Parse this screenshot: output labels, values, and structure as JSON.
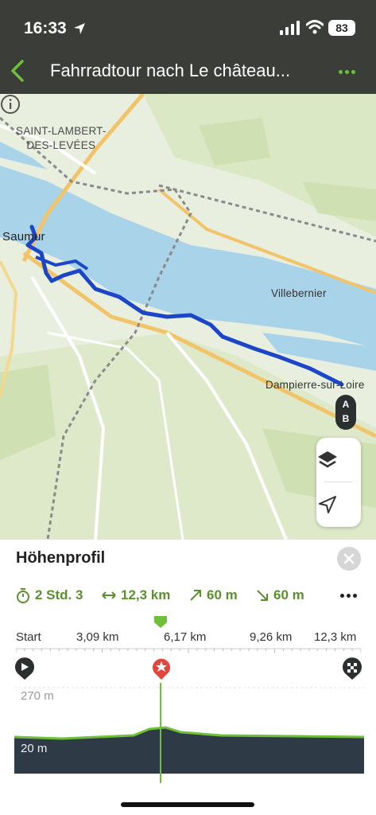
{
  "status_bar": {
    "time": "16:33",
    "battery": "83"
  },
  "header": {
    "title": "Fahrradtour nach Le château..."
  },
  "map": {
    "labels": {
      "town_line1": "SAINT-LAMBERT-",
      "town_line2": "DES-LEVÉES",
      "saumur": "Saumur",
      "villebernier": "Villebernier",
      "dampierre": "Dampierre-sur-Loire"
    },
    "marker": {
      "a": "A",
      "b": "B"
    },
    "route_color": "#1c46c8",
    "water_color": "#a9d3e8"
  },
  "elevation": {
    "title": "Höhenprofil",
    "stats": {
      "duration": "2 Std. 3",
      "distance": "12,3 km",
      "ascent": "60 m",
      "descent": "60 m"
    },
    "axis": [
      "Start",
      "3,09 km",
      "6,17 km",
      "9,26 km",
      "12,3 km"
    ],
    "y_max_label": "270 m",
    "y_min_label": "20 m",
    "accent_color": "#6fbf3a"
  }
}
